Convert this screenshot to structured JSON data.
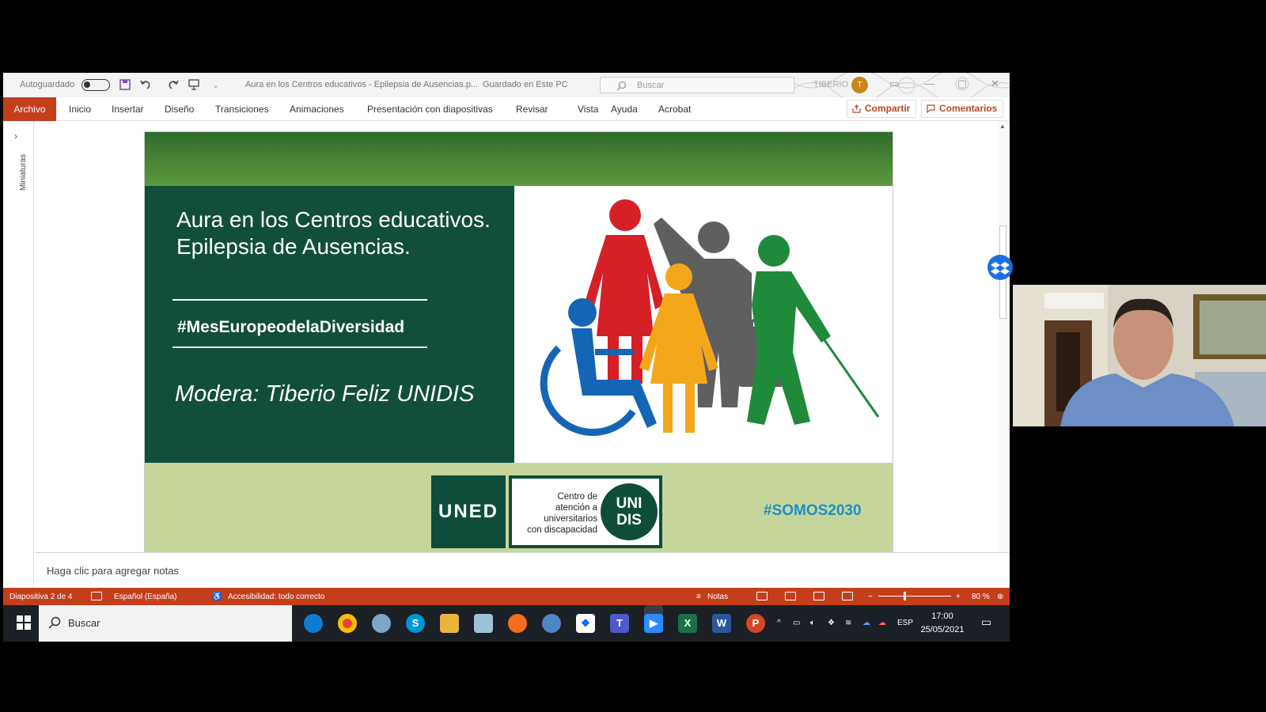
{
  "titlebar": {
    "autosave_label": "Autoguardado",
    "doc_title": "Aura en los Centros educativos - Epilepsia de Ausencias.p...",
    "save_status": "Guardado en Este PC",
    "search_placeholder": "Buscar",
    "user_name": "TIBERIO",
    "user_initial": "T"
  },
  "ribbon": {
    "tabs": [
      "Archivo",
      "Inicio",
      "Insertar",
      "Diseño",
      "Transiciones",
      "Animaciones",
      "Presentación con diapositivas",
      "Revisar",
      "Vista",
      "Ayuda",
      "Acrobat"
    ],
    "share_label": "Compartir",
    "comments_label": "Comentarios"
  },
  "thumbnails": {
    "label": "Miniaturas"
  },
  "slide": {
    "title": "Aura en los Centros educativos. Epilepsia de Ausencias.",
    "hashtag": "#MesEuropeodelaDiversidad",
    "moderator": "Modera: Tiberio Feliz UNIDIS",
    "uned_logo": "UNED",
    "unidis_text": "Centro de\natención a\nuniversitarios\ncon discapacidad",
    "unidis_logo": "UNI\nDIS",
    "somos": "#SOMOS2030"
  },
  "notes": {
    "placeholder": "Haga clic para agregar notas"
  },
  "statusbar": {
    "slide_info": "Diapositiva 2 de 4",
    "language": "Español (España)",
    "accessibility": "Accesibilidad: todo correcto",
    "notes_label": "Notas",
    "zoom_minus": "−",
    "zoom_plus": "+",
    "zoom": "80 %"
  },
  "taskbar": {
    "search_label": "Buscar",
    "lang": "ESP",
    "time": "17:00",
    "date": "25/05/2021"
  },
  "colors": {
    "accent": "#c43e1c",
    "slide_dark_green": "#114f3c",
    "slide_light_green": "#c6d69a"
  }
}
